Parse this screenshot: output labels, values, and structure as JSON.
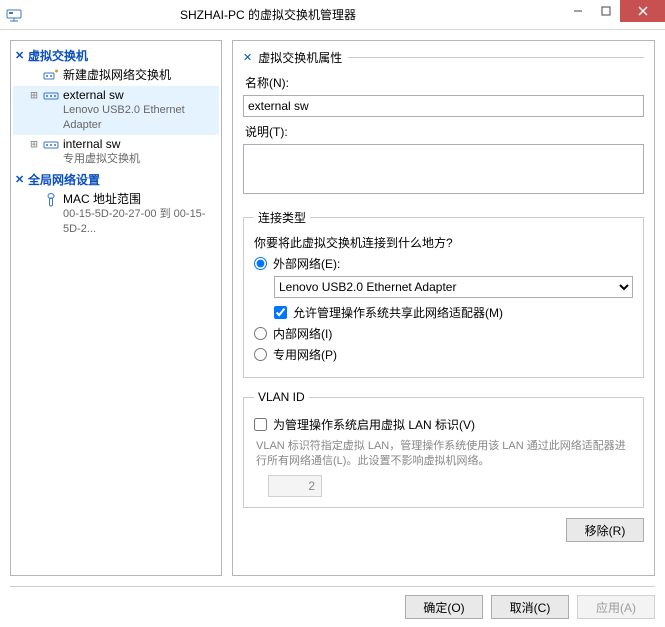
{
  "window": {
    "title": "SHZHAI-PC 的虚拟交换机管理器"
  },
  "tree": {
    "sections": [
      {
        "title": "虚拟交换机",
        "items": [
          {
            "label": "新建虚拟网络交换机",
            "sub": "",
            "expandable": false
          },
          {
            "label": "external sw",
            "sub": "Lenovo USB2.0 Ethernet Adapter",
            "expandable": true,
            "selected": true
          },
          {
            "label": "internal sw",
            "sub": "专用虚拟交换机",
            "expandable": true
          }
        ]
      },
      {
        "title": "全局网络设置",
        "items": [
          {
            "label": "MAC 地址范围",
            "sub": "00-15-5D-20-27-00 到 00-15-5D-2...",
            "expandable": false
          }
        ]
      }
    ]
  },
  "form": {
    "header": "虚拟交换机属性",
    "name_label": "名称(N):",
    "name_value": "external sw",
    "notes_label": "说明(T):",
    "notes_value": "",
    "connection": {
      "legend": "连接类型",
      "question": "你要将此虚拟交换机连接到什么地方?",
      "external_label": "外部网络(E):",
      "external_selected": true,
      "adapter_selected": "Lenovo USB2.0 Ethernet Adapter",
      "allow_mgmt_label": "允许管理操作系统共享此网络适配器(M)",
      "allow_mgmt_checked": true,
      "internal_label": "内部网络(I)",
      "internal_selected": false,
      "private_label": "专用网络(P)",
      "private_selected": false
    },
    "vlan": {
      "legend": "VLAN ID",
      "enable_label": "为管理操作系统启用虚拟 LAN 标识(V)",
      "enable_checked": false,
      "hint": "VLAN 标识符指定虚拟 LAN，管理操作系统使用该 LAN 通过此网络适配器进行所有网络通信(L)。此设置不影响虚拟机网络。",
      "id_value": "2"
    },
    "remove_label": "移除(R)"
  },
  "buttons": {
    "ok": "确定(O)",
    "cancel": "取消(C)",
    "apply": "应用(A)"
  }
}
